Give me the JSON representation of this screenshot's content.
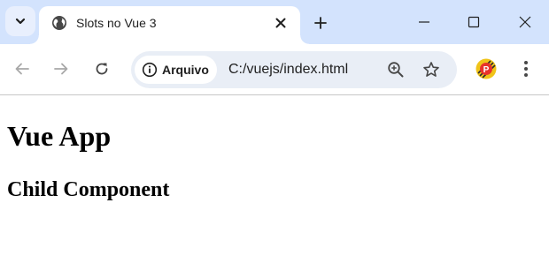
{
  "browser": {
    "tab": {
      "title": "Slots no Vue 3",
      "favicon": "globe-icon"
    },
    "window_controls": [
      "minimize-icon",
      "maximize-icon",
      "close-icon"
    ],
    "toolbar": {
      "site_chip_label": "Arquivo",
      "url": "C:/vuejs/index.html",
      "profile_initial": "P"
    },
    "colors": {
      "tabstrip": "#d3e3fd",
      "omnibox": "#e9eef6",
      "icon": "#474747",
      "avatar": "#e8322b"
    }
  },
  "page": {
    "heading": "Vue App",
    "child_heading": "Child Component"
  }
}
